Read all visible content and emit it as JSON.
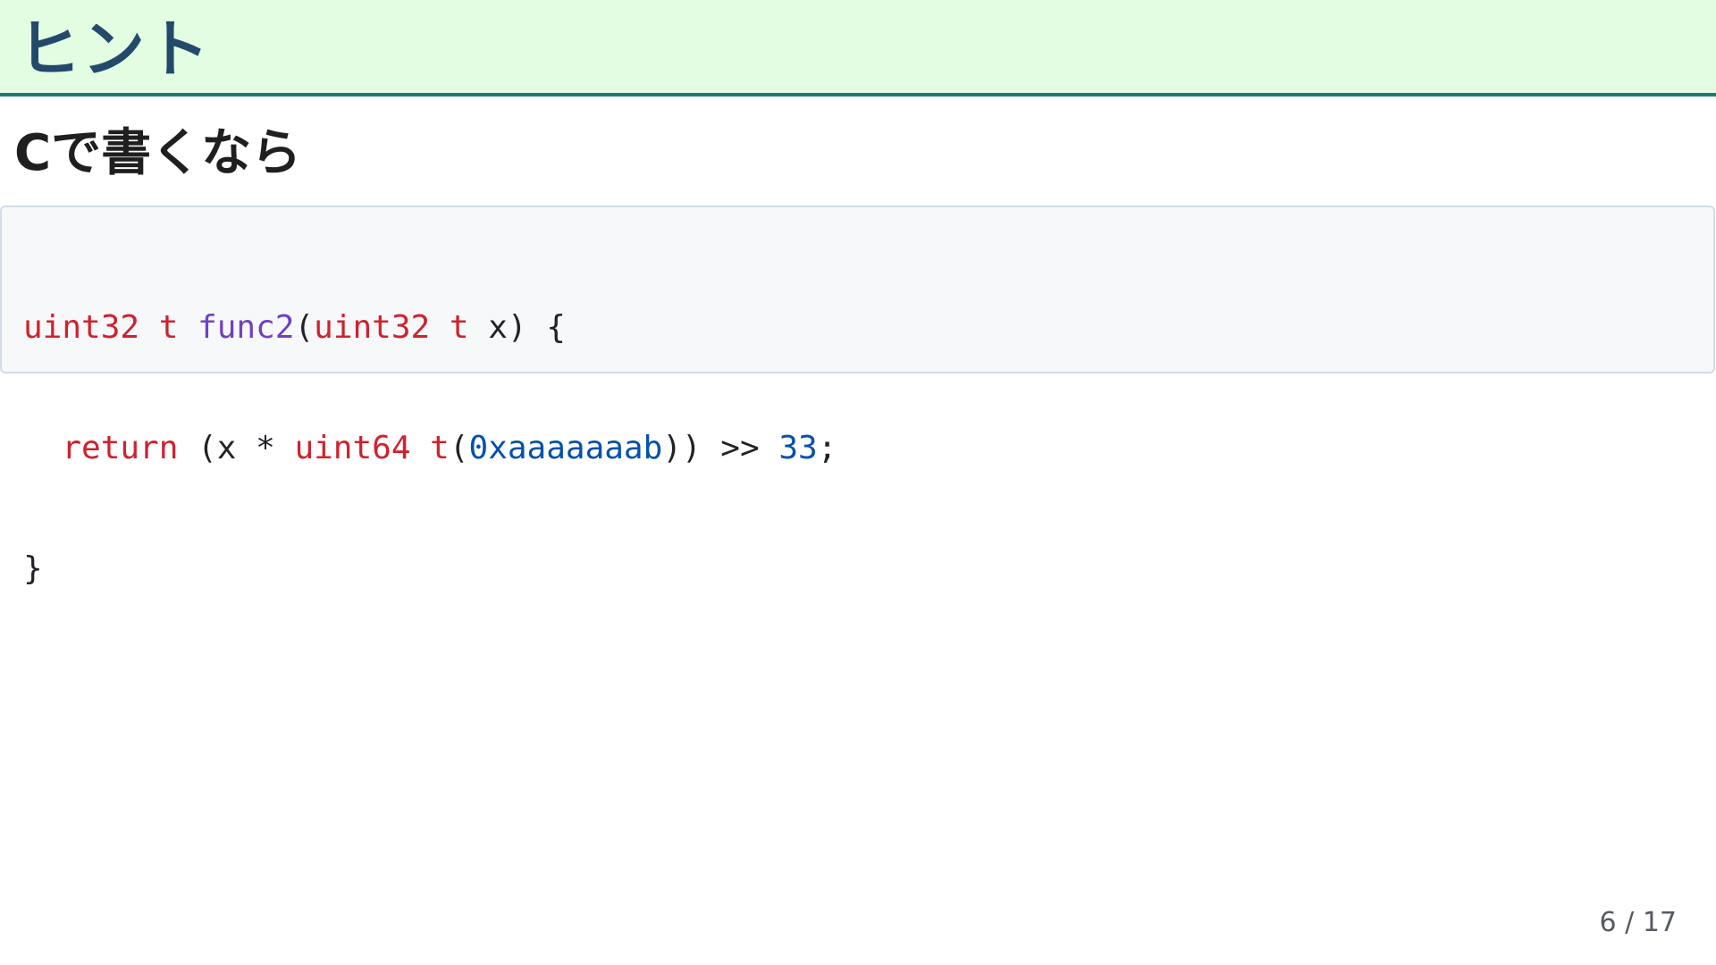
{
  "slide": {
    "title": "ヒント",
    "subtitle": "Cで書くなら",
    "page_number": "6 / 17"
  },
  "code": {
    "language": "c",
    "lines": [
      [
        {
          "text": "uint32 t",
          "kind": "kw"
        },
        {
          "text": " ",
          "kind": "pl"
        },
        {
          "text": "func2",
          "kind": "fn"
        },
        {
          "text": "(",
          "kind": "pl"
        },
        {
          "text": "uint32 t",
          "kind": "kw"
        },
        {
          "text": " x) {",
          "kind": "pl"
        }
      ],
      [
        {
          "text": "  ",
          "kind": "pl"
        },
        {
          "text": "return",
          "kind": "kw"
        },
        {
          "text": " (x * ",
          "kind": "pl"
        },
        {
          "text": "uint64 t",
          "kind": "kw"
        },
        {
          "text": "(",
          "kind": "pl"
        },
        {
          "text": "0xaaaaaaab",
          "kind": "num"
        },
        {
          "text": ")) >> ",
          "kind": "pl"
        },
        {
          "text": "33",
          "kind": "num"
        },
        {
          "text": ";",
          "kind": "pl"
        }
      ],
      [
        {
          "text": "}",
          "kind": "pl"
        }
      ]
    ]
  },
  "colors": {
    "header_bg": "#e3fde3",
    "header_rule": "#1e7a78",
    "title_text": "#23496b",
    "keyword": "#cf222e",
    "function": "#6f42c1",
    "number": "#0550ae"
  }
}
